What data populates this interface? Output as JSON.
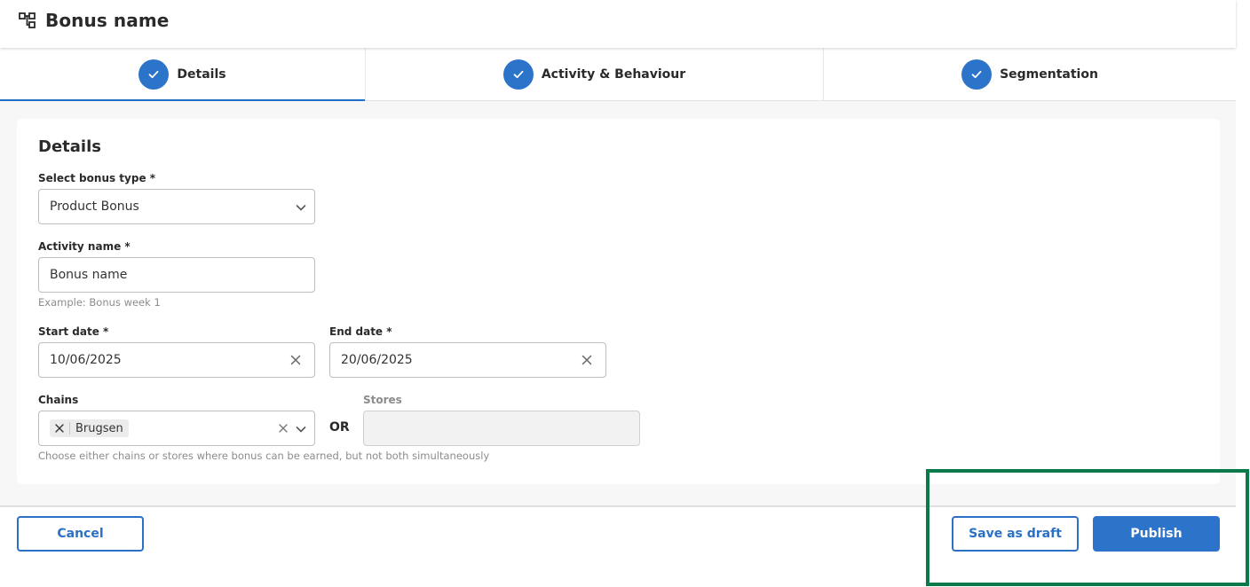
{
  "header": {
    "title": "Bonus name",
    "icon": "hierarchy-icon"
  },
  "tabs": [
    {
      "label": "Details",
      "completed": true,
      "active": true
    },
    {
      "label": "Activity & Behaviour",
      "completed": true,
      "active": false
    },
    {
      "label": "Segmentation",
      "completed": true,
      "active": false
    }
  ],
  "details": {
    "title": "Details",
    "bonus_type": {
      "label": "Select bonus type *",
      "value": "Product Bonus"
    },
    "activity_name": {
      "label": "Activity name *",
      "value": "Bonus name",
      "helper": "Example: Bonus week 1"
    },
    "start_date": {
      "label": "Start date *",
      "value": "10/06/2025"
    },
    "end_date": {
      "label": "End date *",
      "value": "20/06/2025"
    },
    "chains": {
      "label": "Chains",
      "chip": "Brugsen"
    },
    "or_label": "OR",
    "stores": {
      "label": "Stores",
      "value": ""
    },
    "helper": "Choose either chains or stores where bonus can be earned, but not both simultaneously"
  },
  "footer": {
    "cancel_label": "Cancel",
    "save_draft_label": "Save as draft",
    "publish_label": "Publish"
  },
  "colors": {
    "primary": "#2c74c9",
    "highlight": "#0a7a4a",
    "text": "#2a2a2a"
  }
}
